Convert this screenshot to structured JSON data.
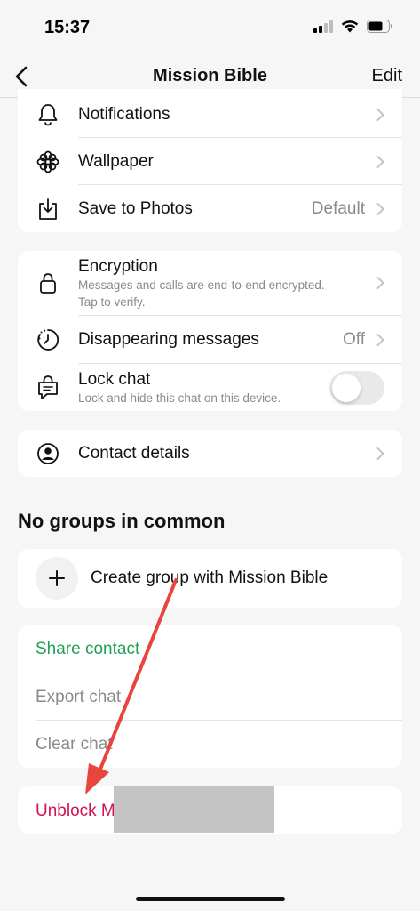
{
  "status_bar": {
    "time": "15:37"
  },
  "nav": {
    "title": "Mission Bible",
    "edit": "Edit"
  },
  "media_section": {
    "notifications": "Notifications",
    "wallpaper": "Wallpaper",
    "save_to_photos": "Save to Photos",
    "save_to_photos_value": "Default"
  },
  "privacy_section": {
    "encryption": "Encryption",
    "encryption_sub_1": "Messages and calls are end-to-end encrypted.",
    "encryption_sub_2": "Tap to verify.",
    "disappearing": "Disappearing messages",
    "disappearing_value": "Off",
    "lock_chat": "Lock chat",
    "lock_chat_sub": "Lock and hide this chat on this device.",
    "lock_chat_enabled": false
  },
  "contact_section": {
    "contact_details": "Contact details"
  },
  "groups": {
    "title": "No groups in common",
    "create_group": "Create group with Mission Bible"
  },
  "actions": {
    "share_contact": "Share contact",
    "export_chat": "Export chat",
    "clear_chat": "Clear chat"
  },
  "danger": {
    "unblock": "Unblock Mission Bible"
  },
  "colors": {
    "accent_green": "#1f9f54",
    "danger_red": "#d1134f",
    "annotation_arrow": "#e8453c"
  }
}
